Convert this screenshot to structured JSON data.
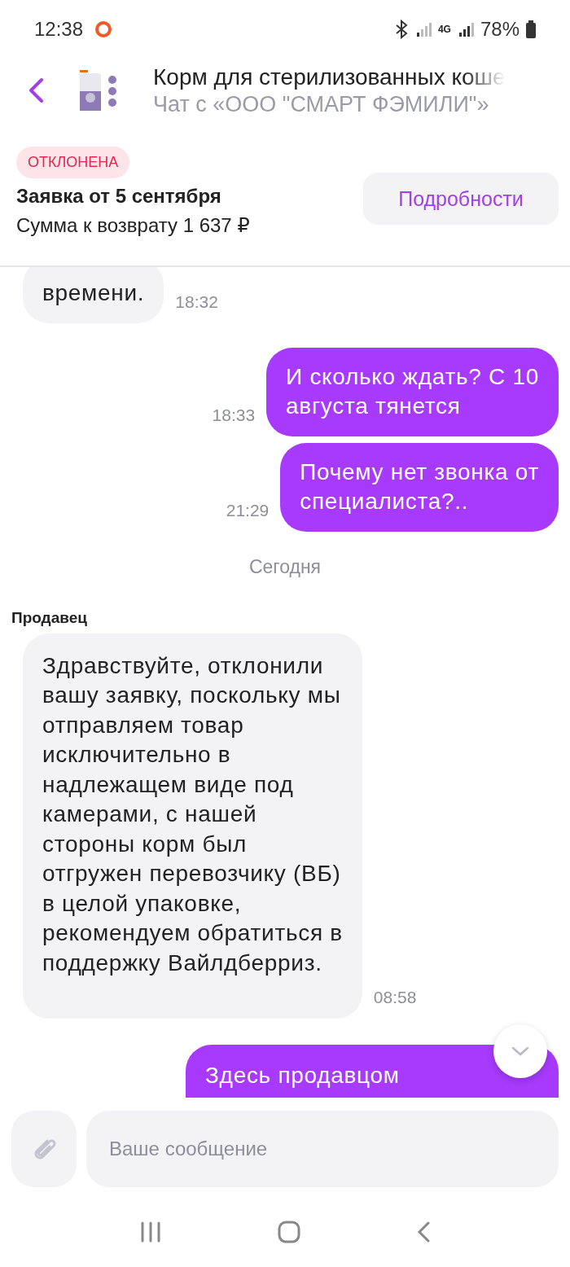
{
  "status_bar": {
    "time": "12:38",
    "battery": "78%",
    "network": "4G"
  },
  "header": {
    "title": "Корм для стерилизованных коше",
    "subtitle": "Чат с «ООО \"СМАРТ ФЭМИЛИ\"»"
  },
  "claim": {
    "status": "ОТКЛОНЕНА",
    "title": "Заявка от 5 сентября",
    "amount": "Сумма к возврату 1 637 ₽",
    "button": "Подробности"
  },
  "messages": [
    {
      "kind": "incoming",
      "text": "времени.",
      "time": "18:32"
    },
    {
      "kind": "outgoing",
      "text": "И сколько ждать? С 10\nавгуста тянется",
      "time": "18:33"
    },
    {
      "kind": "outgoing",
      "text": "Почему нет звонка от\nспециалиста?..",
      "time": "21:29"
    },
    {
      "kind": "date",
      "text": "Сегодня"
    },
    {
      "kind": "sender",
      "text": "Продавец"
    },
    {
      "kind": "incoming",
      "text": "Здравствуйте, отклонили\nвашу заявку, поскольку мы\nотправляем товар\nисключительно в\nнадлежащем виде под\nкамерами, с нашей\nстороны корм был\nотгружен перевозчику (ВБ)\nв целой упаковке,\nрекомендуем обратиться в\nподдержку Вайлдберриз.",
      "time": "08:58"
    },
    {
      "kind": "outgoing",
      "text": "Здесь продавцом"
    }
  ],
  "composer": {
    "placeholder": "Ваше сообщение"
  }
}
